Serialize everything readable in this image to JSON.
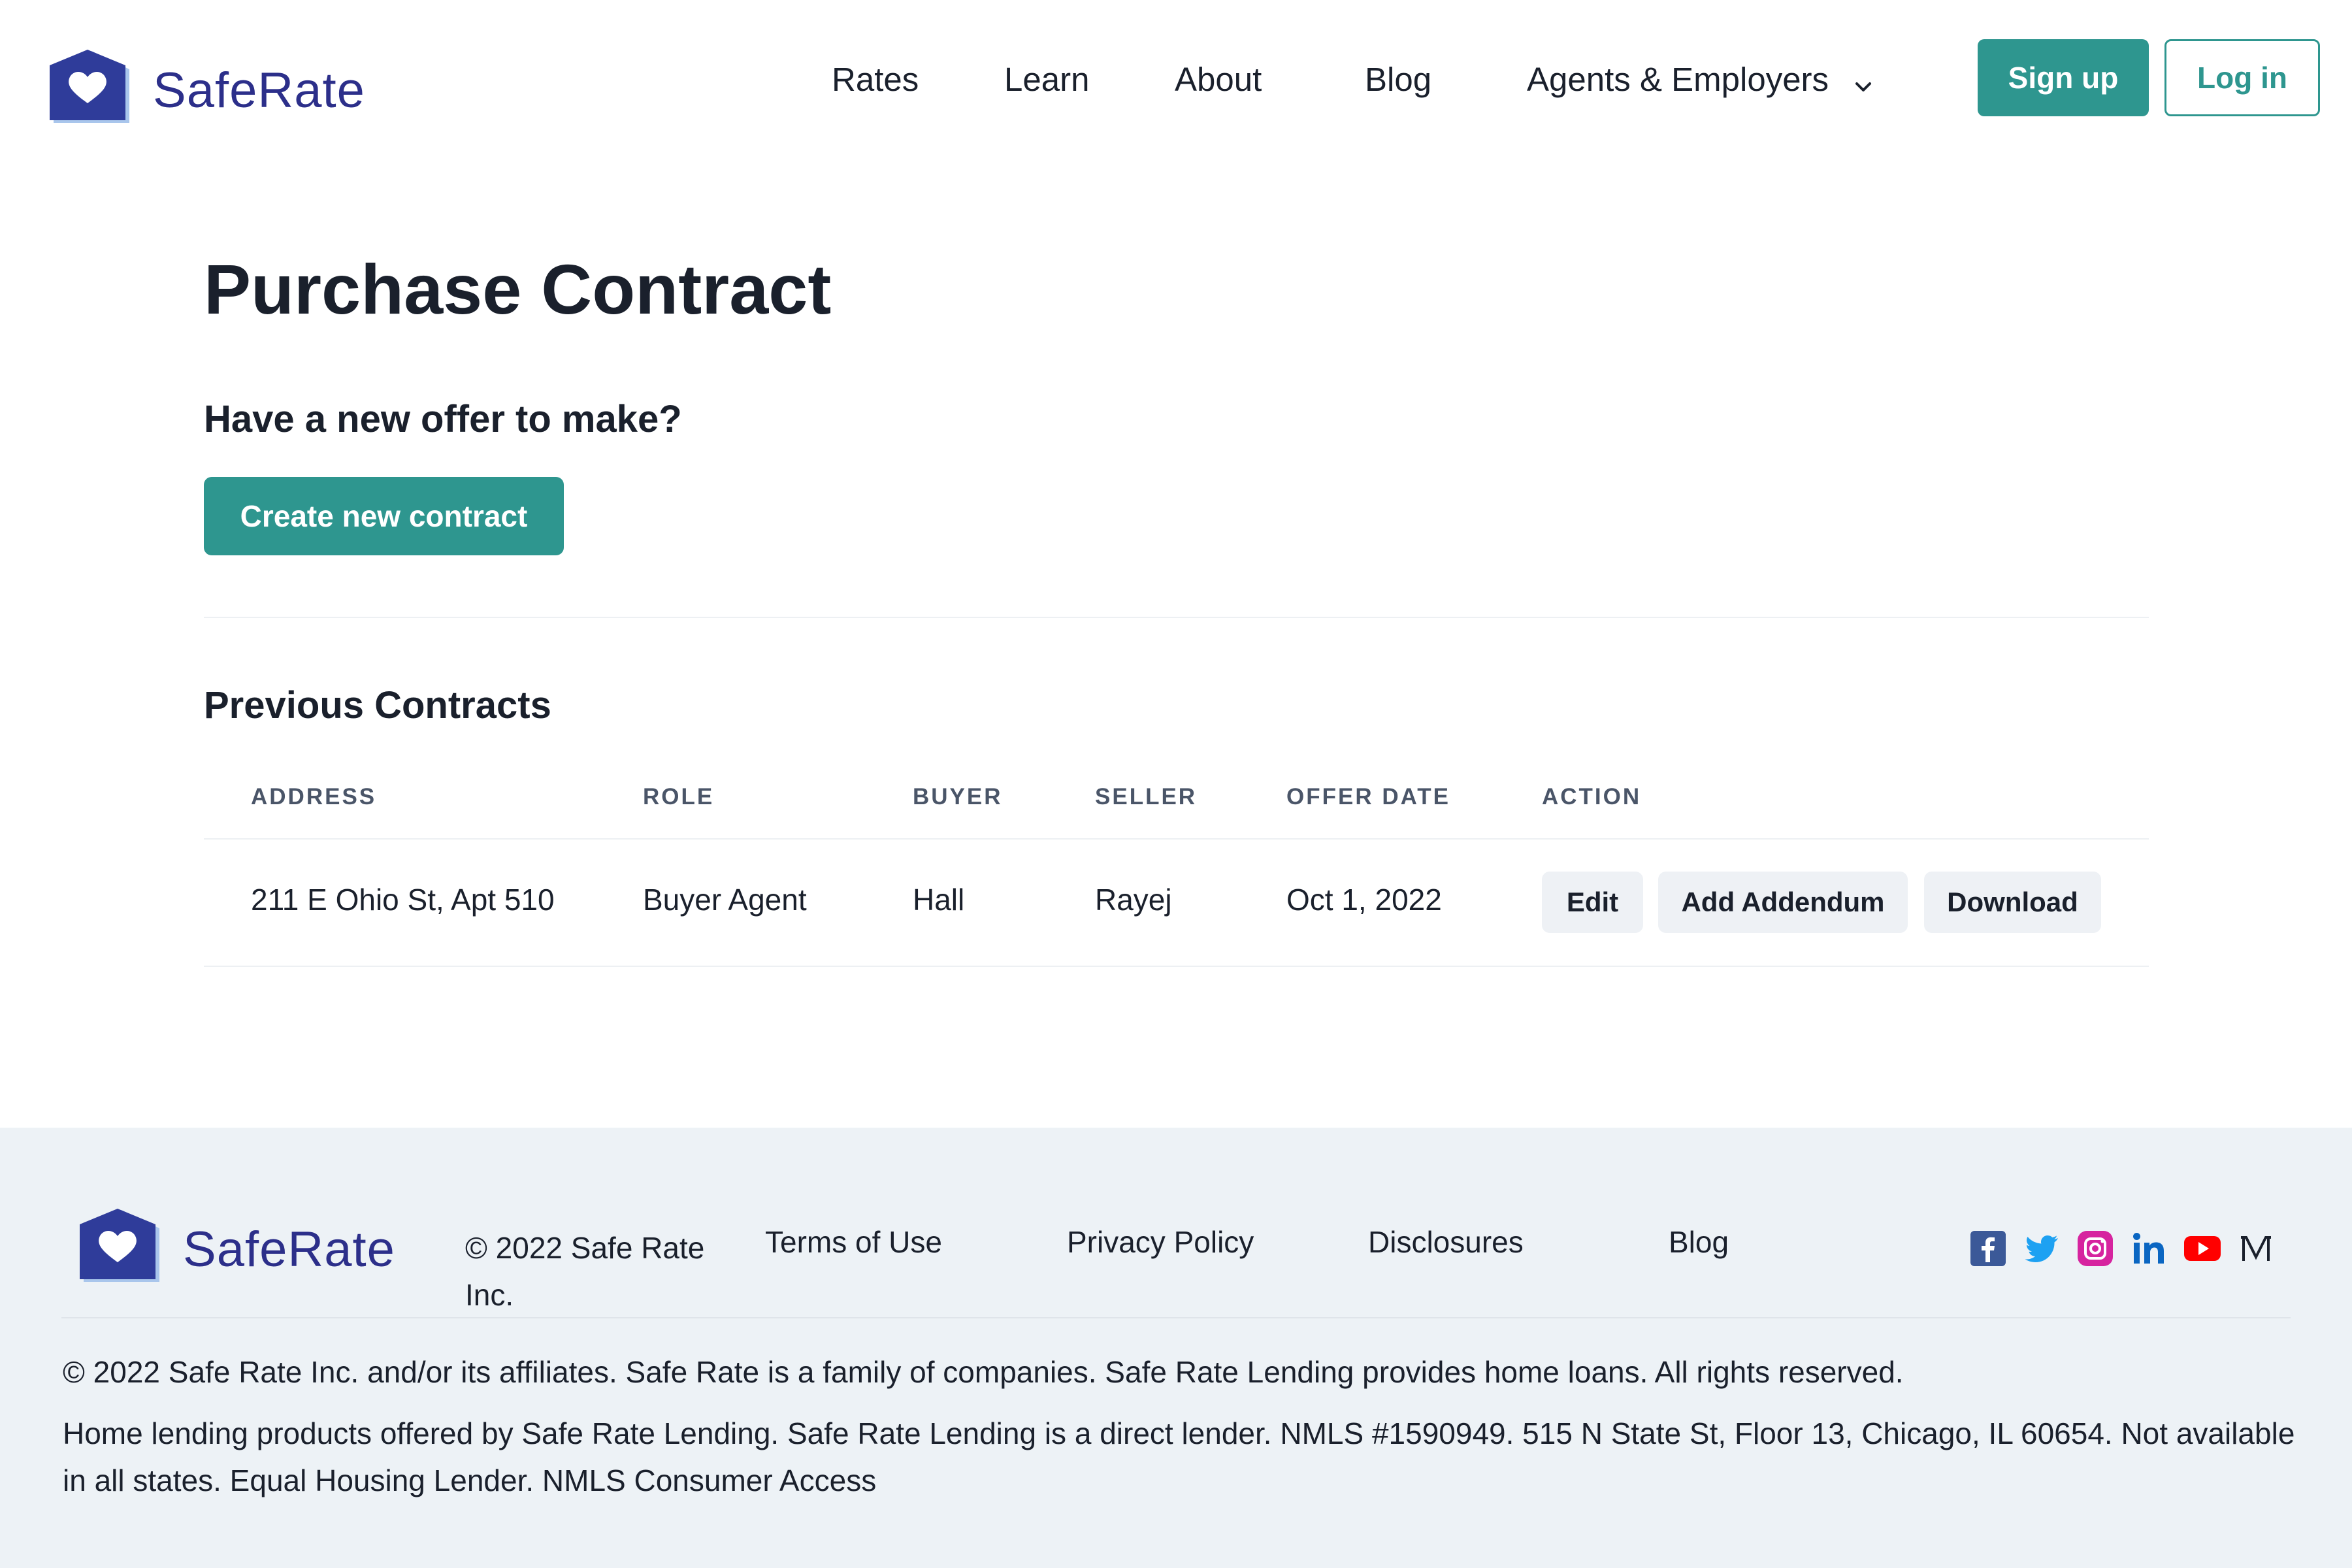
{
  "brand": {
    "name": "SafeRate"
  },
  "nav": {
    "rates": "Rates",
    "learn": "Learn",
    "about": "About",
    "blog": "Blog",
    "agents": "Agents & Employers",
    "signup": "Sign up",
    "login": "Log in"
  },
  "main": {
    "title": "Purchase Contract",
    "subtitle": "Have a new offer to make?",
    "create_button": "Create new contract",
    "previous_title": "Previous Contracts",
    "table": {
      "columns": [
        "ADDRESS",
        "ROLE",
        "BUYER",
        "SELLER",
        "OFFER DATE",
        "ACTION"
      ],
      "rows": [
        {
          "address": "211 E Ohio St, Apt 510",
          "role": "Buyer Agent",
          "buyer": "Hall",
          "seller": "Rayej",
          "offer_date": "Oct 1, 2022",
          "actions": [
            "Edit",
            "Add Addendum",
            "Download"
          ]
        }
      ]
    }
  },
  "footer": {
    "copyright_short": "© 2022 Safe Rate Inc.",
    "links": [
      "Terms of Use",
      "Privacy Policy",
      "Disclosures",
      "Blog"
    ],
    "socials": [
      "facebook-icon",
      "twitter-icon",
      "instagram-icon",
      "linkedin-icon",
      "youtube-icon",
      "medium-icon"
    ],
    "legal_1": "© 2022 Safe Rate Inc. and/or its affiliates. Safe Rate is a family of companies. Safe Rate Lending provides home loans. All rights reserved.",
    "legal_2": "Home lending products offered by Safe Rate Lending. Safe Rate Lending is a direct lender. NMLS #1590949. 515 N State St, Floor 13, Chicago, IL 60654. Not available in all states. Equal Housing Lender. NMLS Consumer Access"
  },
  "colors": {
    "accent": "#2e968f",
    "brand": "#2c2f8a",
    "footer_bg": "#edf2f6"
  }
}
